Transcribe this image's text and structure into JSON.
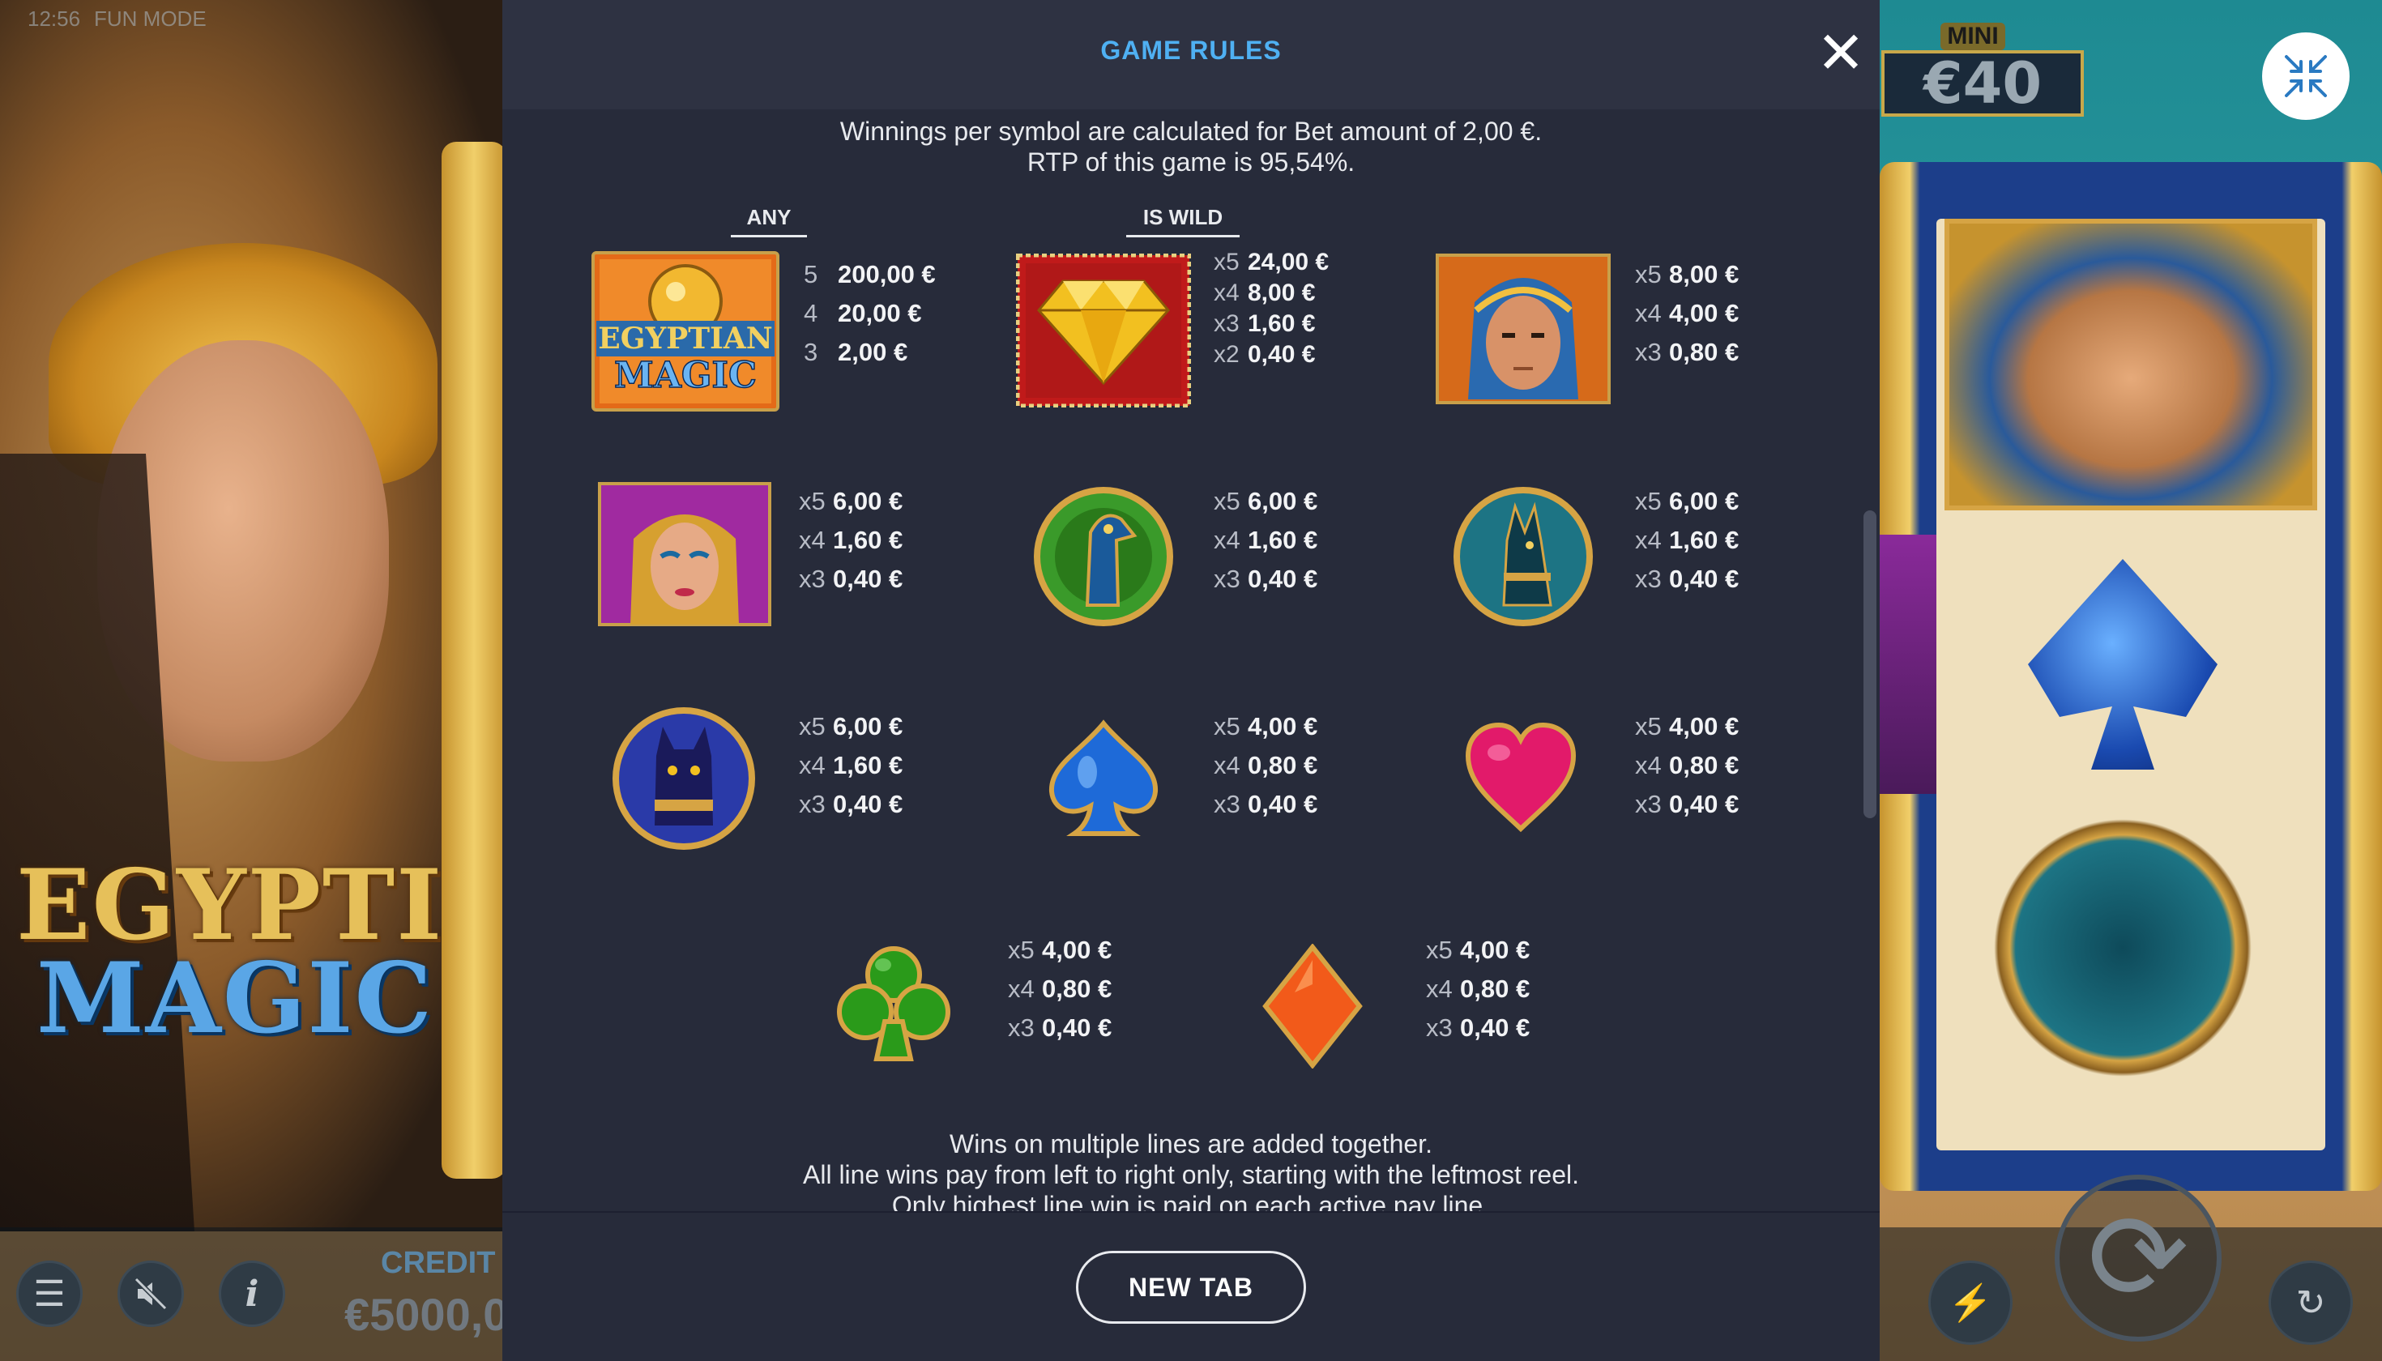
{
  "status_bar": {
    "time": "12:56",
    "mode": "FUN MODE"
  },
  "jackpot": {
    "label": "MINI",
    "value": "€40"
  },
  "bottom": {
    "credit_label": "CREDIT",
    "credit_value": "€5000,0"
  },
  "game_logo": {
    "line1": "EGYPTIAN",
    "line2": "MAGIC"
  },
  "modal": {
    "title": "GAME RULES",
    "close": "✕",
    "intro_line1": "Winnings per symbol are calculated for Bet amount of 2,00 €.",
    "intro_line2": "RTP of this game is 95,54%.",
    "col_any": "ANY",
    "col_wild": "IS WILD",
    "symbols": [
      {
        "id": "scatter-egyptian-magic",
        "pays": [
          [
            "5",
            "200,00 €"
          ],
          [
            "4",
            "20,00 €"
          ],
          [
            "3",
            "2,00 €"
          ]
        ]
      },
      {
        "id": "wild-diamond",
        "pays": [
          [
            "x5",
            "24,00 €"
          ],
          [
            "x4",
            "8,00 €"
          ],
          [
            "x3",
            "1,60 €"
          ],
          [
            "x2",
            "0,40 €"
          ]
        ]
      },
      {
        "id": "pharaoh",
        "pays": [
          [
            "x5",
            "8,00 €"
          ],
          [
            "x4",
            "4,00 €"
          ],
          [
            "x3",
            "0,80 €"
          ]
        ]
      },
      {
        "id": "cleopatra",
        "pays": [
          [
            "x5",
            "6,00 €"
          ],
          [
            "x4",
            "1,60 €"
          ],
          [
            "x3",
            "0,40 €"
          ]
        ]
      },
      {
        "id": "horus",
        "pays": [
          [
            "x5",
            "6,00 €"
          ],
          [
            "x4",
            "1,60 €"
          ],
          [
            "x3",
            "0,40 €"
          ]
        ]
      },
      {
        "id": "anubis",
        "pays": [
          [
            "x5",
            "6,00 €"
          ],
          [
            "x4",
            "1,60 €"
          ],
          [
            "x3",
            "0,40 €"
          ]
        ]
      },
      {
        "id": "bastet",
        "pays": [
          [
            "x5",
            "6,00 €"
          ],
          [
            "x4",
            "1,60 €"
          ],
          [
            "x3",
            "0,40 €"
          ]
        ]
      },
      {
        "id": "spade",
        "pays": [
          [
            "x5",
            "4,00 €"
          ],
          [
            "x4",
            "0,80 €"
          ],
          [
            "x3",
            "0,40 €"
          ]
        ]
      },
      {
        "id": "heart",
        "pays": [
          [
            "x5",
            "4,00 €"
          ],
          [
            "x4",
            "0,80 €"
          ],
          [
            "x3",
            "0,40 €"
          ]
        ]
      },
      {
        "id": "club",
        "pays": [
          [
            "x5",
            "4,00 €"
          ],
          [
            "x4",
            "0,80 €"
          ],
          [
            "x3",
            "0,40 €"
          ]
        ]
      },
      {
        "id": "diamond-suit",
        "pays": [
          [
            "x5",
            "4,00 €"
          ],
          [
            "x4",
            "0,80 €"
          ],
          [
            "x3",
            "0,40 €"
          ]
        ]
      }
    ],
    "footer_line1": "Wins on multiple lines are added together.",
    "footer_line2": "All line wins pay from left to right only, starting with the leftmost reel.",
    "footer_line3": "Only highest line win is paid on each active pay line.",
    "new_tab": "NEW TAB"
  },
  "icons": {
    "menu": "menu-icon",
    "sound": "sound-off-icon",
    "info": "info-icon",
    "collapse": "collapse-icon",
    "autoplay": "autoplay-icon",
    "spin": "spin-icon",
    "turbo": "turbo-icon"
  }
}
